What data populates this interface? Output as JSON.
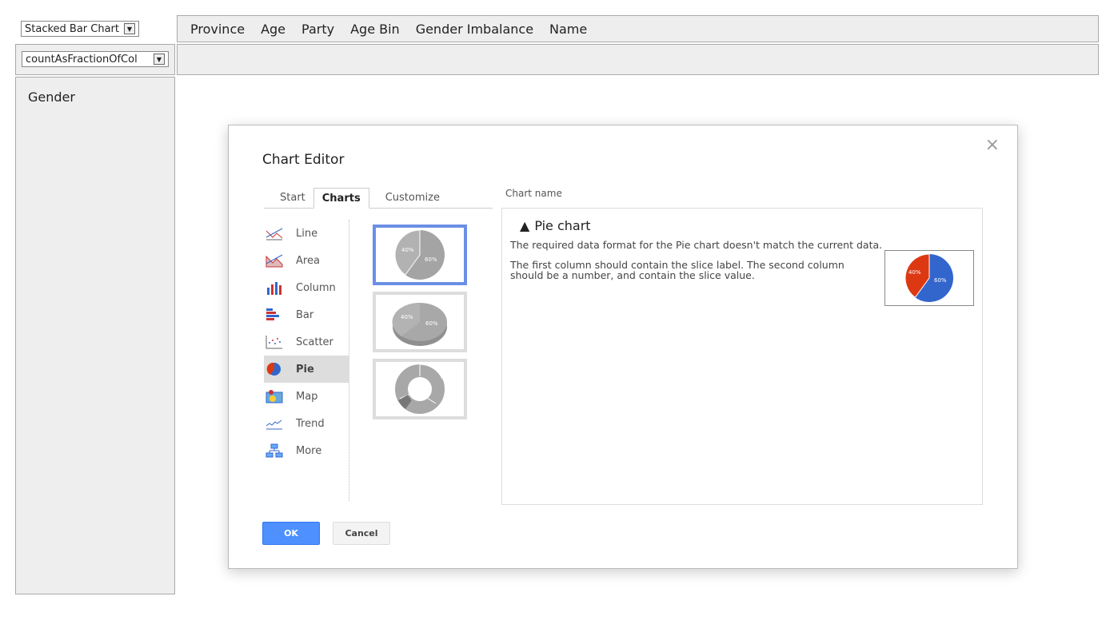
{
  "chart_type_select": {
    "value": "Stacked Bar Chart"
  },
  "aggregator_select": {
    "value": "countAsFractionOfCol"
  },
  "header_fields": [
    "Province",
    "Age",
    "Party",
    "Age Bin",
    "Gender Imbalance",
    "Name"
  ],
  "row_field": "Gender",
  "dialog": {
    "title": "Chart Editor",
    "tabs": [
      "Start",
      "Charts",
      "Customize"
    ],
    "active_tab": "Charts",
    "chart_types": [
      "Line",
      "Area",
      "Column",
      "Bar",
      "Scatter",
      "Pie",
      "Map",
      "Trend",
      "More"
    ],
    "selected_type": "Pie",
    "chart_name_label": "Chart name",
    "thumb_labels": {
      "small": "40%",
      "large": "60%"
    },
    "preview": {
      "title": "Pie chart",
      "msg1": "The required data format for the Pie chart doesn't match the current data.",
      "msg2": "The first column should contain the slice label. The second column should be a number, and contain the slice value.",
      "slices": [
        {
          "label": "60%",
          "value": 60,
          "color": "#3366cc"
        },
        {
          "label": "40%",
          "value": 40,
          "color": "#dc3912"
        }
      ]
    },
    "ok_label": "OK",
    "cancel_label": "Cancel",
    "close_icon": "×"
  }
}
